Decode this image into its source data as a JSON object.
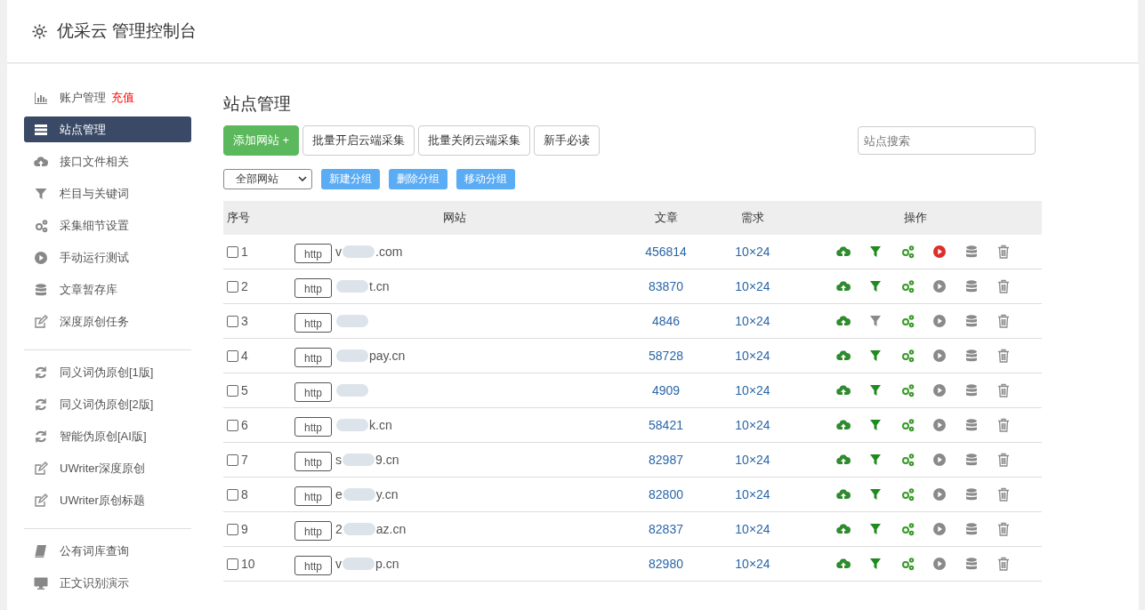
{
  "header": {
    "title": "优采云 管理控制台"
  },
  "sidebar": {
    "groups": [
      [
        {
          "label": "账户管理",
          "kind": "chart",
          "link": "充值",
          "selected": false
        },
        {
          "label": "站点管理",
          "kind": "list",
          "selected": true
        },
        {
          "label": "接口文件相关",
          "kind": "cloud",
          "selected": false
        },
        {
          "label": "栏目与关键词",
          "kind": "filter",
          "selected": false
        },
        {
          "label": "采集细节设置",
          "kind": "gears",
          "selected": false
        },
        {
          "label": "手动运行测试",
          "kind": "play",
          "selected": false
        },
        {
          "label": "文章暂存库",
          "kind": "database",
          "selected": false
        },
        {
          "label": "深度原创任务",
          "kind": "edit",
          "selected": false
        }
      ],
      [
        {
          "label": "同义词伪原创[1版]",
          "kind": "refresh",
          "selected": false
        },
        {
          "label": "同义词伪原创[2版]",
          "kind": "refresh",
          "selected": false
        },
        {
          "label": "智能伪原创[AI版]",
          "kind": "refresh",
          "selected": false
        },
        {
          "label": "UWriter深度原创",
          "kind": "edit",
          "selected": false
        },
        {
          "label": "UWriter原创标题",
          "kind": "edit",
          "selected": false
        }
      ],
      [
        {
          "label": "公有词库查询",
          "kind": "book",
          "selected": false
        },
        {
          "label": "正文识别演示",
          "kind": "monitor",
          "selected": false
        }
      ]
    ]
  },
  "main": {
    "title": "站点管理",
    "buttons": [
      {
        "label": "添加网站 +",
        "kind": "primary"
      },
      {
        "label": "批量开启云端采集",
        "kind": "default"
      },
      {
        "label": "批量关闭云端采集",
        "kind": "default"
      },
      {
        "label": "新手必读",
        "kind": "default"
      }
    ],
    "search": {
      "placeholder": "站点搜索"
    },
    "group_select": "全部网站",
    "group_buttons": [
      "新建分组",
      "删除分组",
      "移动分组"
    ],
    "table": {
      "columns": [
        "序号",
        "网站",
        "文章",
        "需求",
        "操作"
      ],
      "rows": [
        {
          "index": "1",
          "checked": false,
          "scheme": "http",
          "url_start": "v",
          "url_end": ".com",
          "articles": "456814",
          "demand": "10×24",
          "filter_active": true,
          "running": true
        },
        {
          "index": "2",
          "checked": false,
          "scheme": "http",
          "url_end": "t.cn",
          "articles": "83870",
          "demand": "10×24",
          "filter_active": true,
          "running": false
        },
        {
          "index": "3",
          "checked": false,
          "scheme": "http",
          "articles": "4846",
          "demand": "10×24",
          "filter_active": false,
          "running": false
        },
        {
          "index": "4",
          "checked": false,
          "scheme": "http",
          "url_end": "pay.cn",
          "articles": "58728",
          "demand": "10×24",
          "filter_active": true,
          "running": false
        },
        {
          "index": "5",
          "checked": false,
          "scheme": "http",
          "articles": "4909",
          "demand": "10×24",
          "filter_active": true,
          "running": false
        },
        {
          "index": "6",
          "checked": false,
          "scheme": "http",
          "url_end": "k.cn",
          "articles": "58421",
          "demand": "10×24",
          "filter_active": true,
          "running": false
        },
        {
          "index": "7",
          "checked": false,
          "scheme": "http",
          "url_start": "s",
          "url_end": "9.cn",
          "articles": "82987",
          "demand": "10×24",
          "filter_active": true,
          "running": false
        },
        {
          "index": "8",
          "checked": false,
          "scheme": "http",
          "url_start": "e",
          "url_end": "y.cn",
          "articles": "82800",
          "demand": "10×24",
          "filter_active": true,
          "running": false
        },
        {
          "index": "9",
          "checked": false,
          "scheme": "http",
          "url_start": "2",
          "url_end": "az.cn",
          "articles": "82837",
          "demand": "10×24",
          "filter_active": true,
          "running": false
        },
        {
          "index": "10",
          "checked": false,
          "scheme": "http",
          "url_start": "v",
          "url_end": "p.cn",
          "articles": "82980",
          "demand": "10×24",
          "filter_active": true,
          "running": false
        }
      ]
    }
  }
}
